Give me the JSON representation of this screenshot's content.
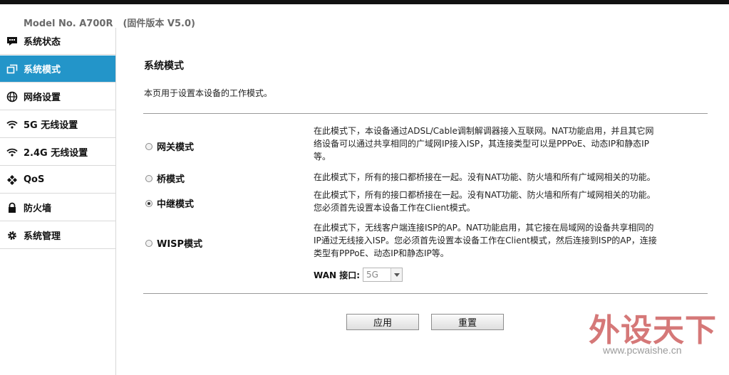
{
  "header": {
    "model": "Model No. A700R",
    "firmware": "(固件版本 V5.0)"
  },
  "sidebar": {
    "items": [
      {
        "label": "系统状态",
        "icon": "chat-bubble-icon",
        "active": false
      },
      {
        "label": "系统模式",
        "icon": "windows-icon",
        "active": true
      },
      {
        "label": "网络设置",
        "icon": "globe-icon",
        "active": false
      },
      {
        "label": "5G  无线设置",
        "icon": "wifi-icon",
        "active": false
      },
      {
        "label": "2.4G  无线设置",
        "icon": "wifi-icon",
        "active": false
      },
      {
        "label": "QoS",
        "icon": "qos-icon",
        "active": false
      },
      {
        "label": "防火墙",
        "icon": "lock-icon",
        "active": false
      },
      {
        "label": "系统管理",
        "icon": "gear-icon",
        "active": false
      }
    ],
    "active_color": "#2395c9"
  },
  "main": {
    "title": "系统模式",
    "description": "本页用于设置本设备的工作模式。",
    "modes": [
      {
        "label": "网关模式",
        "checked": false,
        "desc_lines": [
          "在此模式下，本设备通过ADSL/Cable调制解调器接入互联网。NAT功能启用，并且其它网",
          "络设备可以通过共享相同的广域网IP接入ISP，其连接类型可以是PPPoE、动态IP和静态IP",
          "等。"
        ]
      },
      {
        "label": "桥模式",
        "checked": false,
        "desc_lines": [
          "在此模式下，所有的接口都桥接在一起。没有NAT功能、防火墙和所有广域网相关的功能。"
        ]
      },
      {
        "label": "中继模式",
        "checked": true,
        "desc_lines": [
          "在此模式下，所有的接口都桥接在一起。没有NAT功能、防火墙和所有广域网相关的功能。",
          "您必须首先设置本设备工作在Client模式。"
        ]
      },
      {
        "label": "WISP模式",
        "checked": false,
        "desc_lines": [
          "在此模式下，无线客户端连接ISP的AP。NAT功能启用，其它接在局域网的设备共享相同的",
          "IP通过无线接入ISP。您必须首先设置本设备工作在Client模式，然后连接到ISP的AP，连接",
          "类型有PPPoE、动态IP和静态IP等。"
        ]
      }
    ],
    "wan": {
      "label": "WAN 接口:",
      "value": "5G"
    },
    "apply_label": "应用",
    "reset_label": "重置"
  },
  "watermark": {
    "text": "外设天下",
    "url": "www.pcwaishe.cn",
    "color": "#c54545"
  }
}
